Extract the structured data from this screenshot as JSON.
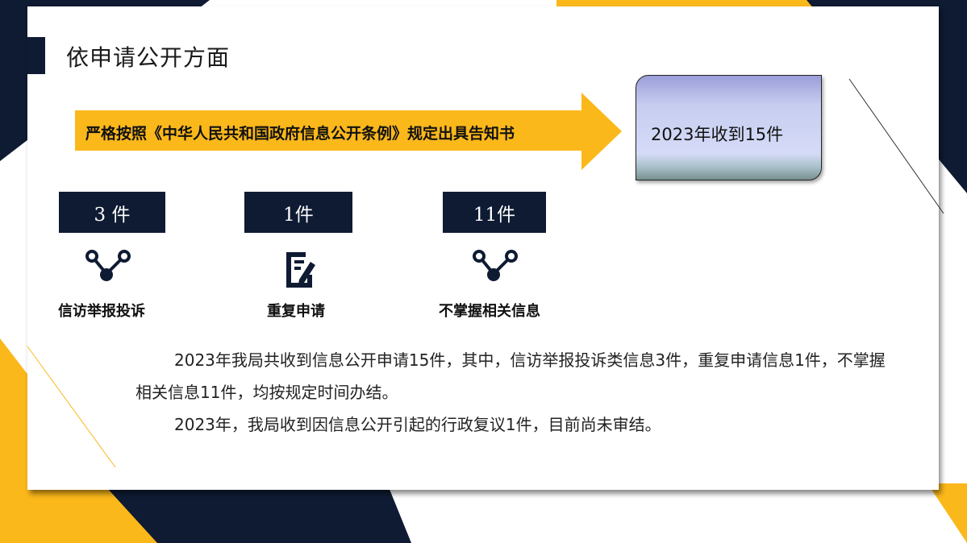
{
  "title": "依申请公开方面",
  "arrow_text": "严格按照《中华人民共和国政府信息公开条例》规定出具告知书",
  "result_box": {
    "text": "2023年收到15件"
  },
  "categories": [
    {
      "count": "3 件",
      "label": "信访举报投诉",
      "icon": "connection-nodes-icon"
    },
    {
      "count": "1件",
      "label": "重复申请",
      "icon": "edit-document-icon"
    },
    {
      "count": "11件",
      "label": "不掌握相关信息",
      "icon": "connection-nodes-icon"
    }
  ],
  "paragraphs": [
    "2023年我局共收到信息公开申请15件，其中，信访举报投诉类信息3件，重复申请信息1件，不掌握相关信息11件，均按规定时间办结。",
    "2023年，我局收到因信息公开引起的行政复议1件，目前尚未审结。"
  ],
  "colors": {
    "navy": "#0f1b33",
    "gold": "#fbb81b"
  }
}
